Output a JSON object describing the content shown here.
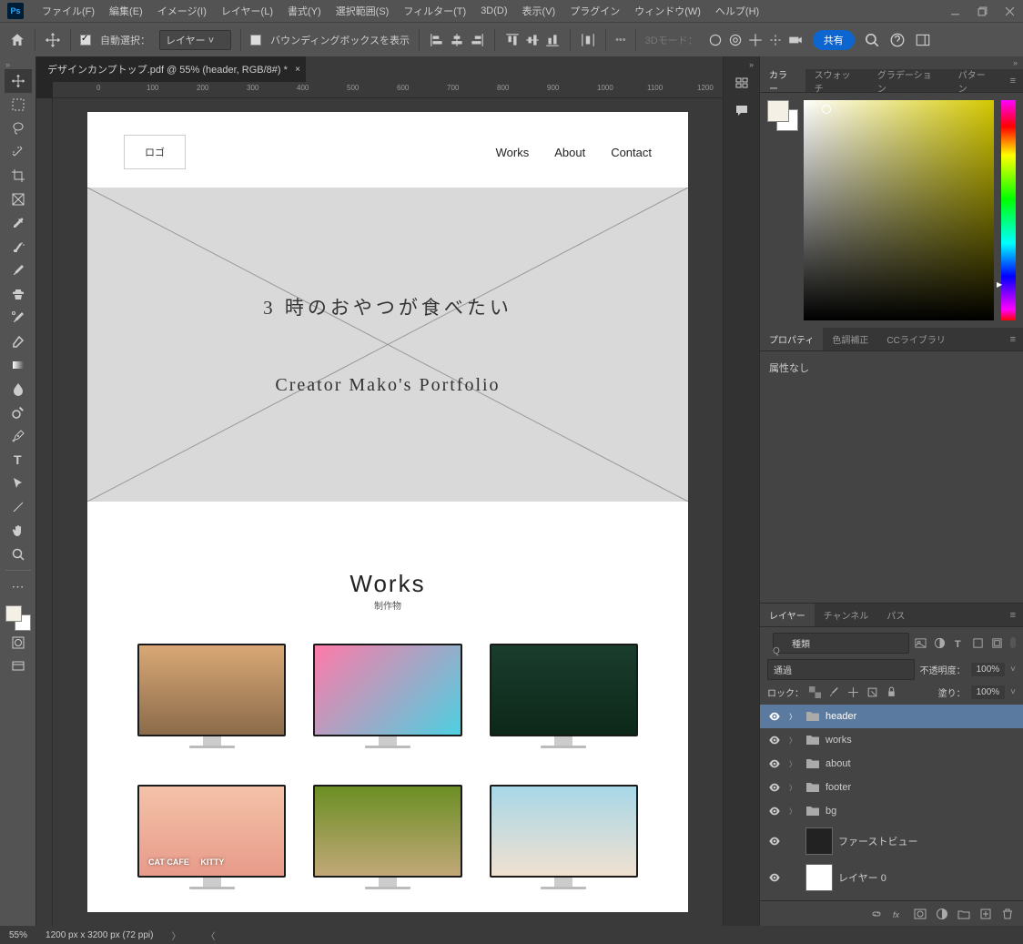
{
  "menu": [
    "ファイル(F)",
    "編集(E)",
    "イメージ(I)",
    "レイヤー(L)",
    "書式(Y)",
    "選択範囲(S)",
    "フィルター(T)",
    "3D(D)",
    "表示(V)",
    "プラグイン",
    "ウィンドウ(W)",
    "ヘルプ(H)"
  ],
  "options": {
    "autoSelect": "自動選択：",
    "targetSelect": "レイヤー",
    "bounding": "バウンディングボックスを表示",
    "mode3d": "3Dモード：",
    "share": "共有"
  },
  "document": {
    "tabTitle": "デザインカンプトップ.pdf @ 55% (header, RGB/8#) *",
    "rulerTicks": [
      "0",
      "100",
      "200",
      "300",
      "400",
      "500",
      "600",
      "700",
      "800",
      "900",
      "1000",
      "1100",
      "1200"
    ]
  },
  "design": {
    "logo": "ロゴ",
    "nav": [
      "Works",
      "About",
      "Contact"
    ],
    "heroText1": "3 時のおやつが食べたい",
    "heroText2": "Creator Mako's Portfolio",
    "worksTitle": "Works",
    "worksSub": "制作物",
    "thumb4": "CAT CAFE",
    "thumb4b": "KITTY"
  },
  "panels": {
    "colorTabs": [
      "カラー",
      "スウォッチ",
      "グラデーション",
      "パターン"
    ],
    "propTabs": [
      "プロパティ",
      "色調補正",
      "CCライブラリ"
    ],
    "propBody": "属性なし",
    "layerTabs": [
      "レイヤー",
      "チャンネル",
      "パス"
    ],
    "layerFilter": "種類",
    "blendMode": "通過",
    "opacityLabel": "不透明度：",
    "opacityVal": "100%",
    "lockLabel": "ロック：",
    "fillLabel": "塗り：",
    "fillVal": "100%",
    "layers": [
      {
        "name": "header",
        "type": "folder",
        "selected": true
      },
      {
        "name": "works",
        "type": "folder"
      },
      {
        "name": "about",
        "type": "folder"
      },
      {
        "name": "footer",
        "type": "folder"
      },
      {
        "name": "bg",
        "type": "folder"
      },
      {
        "name": "ファーストビュー",
        "type": "layer"
      },
      {
        "name": "レイヤー 0",
        "type": "layer",
        "white": true
      }
    ]
  },
  "status": {
    "zoom": "55%",
    "dims": "1200 px x 3200 px (72 ppi)"
  }
}
